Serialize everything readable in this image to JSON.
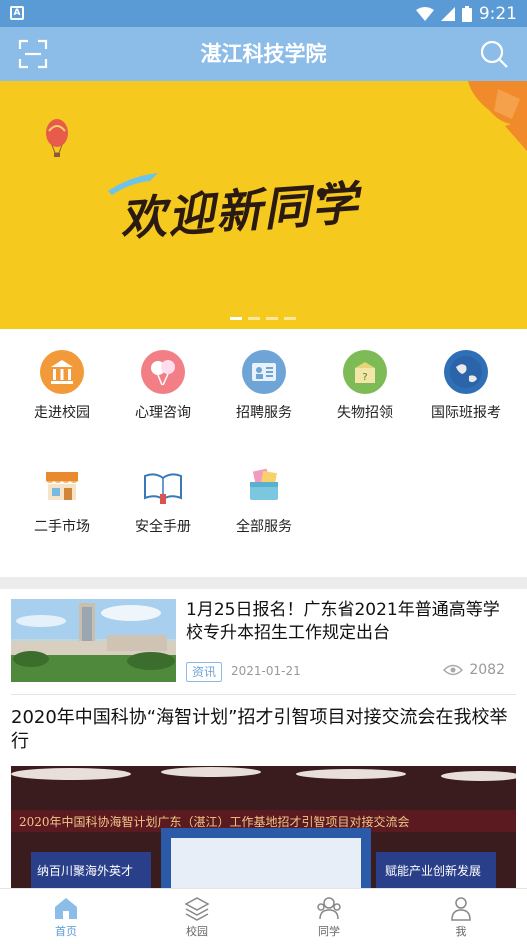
{
  "status_bar": {
    "time": "9:21",
    "left_icon_letter": "A"
  },
  "header": {
    "title": "湛江科技学院",
    "scan_icon": "scan-icon",
    "search_icon": "search-icon"
  },
  "banner": {
    "text": "欢迎新同学",
    "pages": 4,
    "active_page": 1
  },
  "grid": {
    "items": [
      {
        "label": "走进校园",
        "icon": "campus-building-icon",
        "color": "#f29a3a"
      },
      {
        "label": "心理咨询",
        "icon": "balloon-heart-icon",
        "color": "#f27f86"
      },
      {
        "label": "招聘服务",
        "icon": "recruitment-icon",
        "color": "#6fa4d6"
      },
      {
        "label": "失物招领",
        "icon": "lost-found-icon",
        "color": "#7dbb57"
      },
      {
        "label": "国际班报考",
        "icon": "globe-icon",
        "color": "#2f6fb5"
      },
      {
        "label": "二手市场",
        "icon": "market-stall-icon",
        "color": "#ea8a2e"
      },
      {
        "label": "安全手册",
        "icon": "open-book-icon",
        "color": "#4a8cc9"
      },
      {
        "label": "全部服务",
        "icon": "all-services-icon",
        "color": "#5bb8d0"
      }
    ]
  },
  "news": [
    {
      "title": "1月25日报名！广东省2021年普通高等学校专升本招生工作规定出台",
      "tag": "资讯",
      "date": "2021-01-21",
      "views": "2082"
    },
    {
      "title": "2020年中国科协“海智计划”招才引智项目对接交流会在我校举行",
      "photo_caption": "2020年中国科协海智计划广东（湛江）工作基地招才引智项目对接交流会",
      "photo_sign_left": "纳百川聚海外英才",
      "photo_sign_right": "赋能产业创新发展"
    }
  ],
  "bottom_nav": {
    "tabs": [
      {
        "label": "首页",
        "icon": "home-icon",
        "active": true
      },
      {
        "label": "校园",
        "icon": "layers-icon",
        "active": false
      },
      {
        "label": "同学",
        "icon": "classmates-icon",
        "active": false
      },
      {
        "label": "我",
        "icon": "profile-icon",
        "active": false
      }
    ]
  }
}
